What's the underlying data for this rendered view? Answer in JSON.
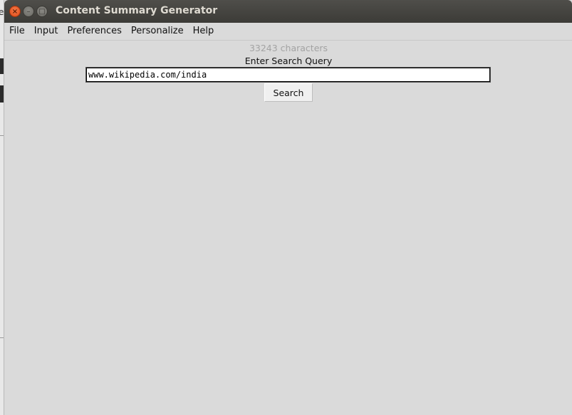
{
  "window": {
    "title": "Content Summary Generator",
    "close_glyph": "×",
    "minimize_glyph": "–",
    "maximize_glyph": "□"
  },
  "desktop": {
    "edge_glyph": "e"
  },
  "menu": {
    "items": [
      "File",
      "Input",
      "Preferences",
      "Personalize",
      "Help"
    ]
  },
  "main": {
    "char_count": "33243 characters",
    "query_label": "Enter Search Query",
    "query_value": "www.wikipedia.com/india",
    "search_button": "Search"
  },
  "colors": {
    "titlebar": "#3c3b37",
    "close_button": "#df4a16",
    "window_bg": "#dadada",
    "char_count_text": "#a3a3a3"
  }
}
